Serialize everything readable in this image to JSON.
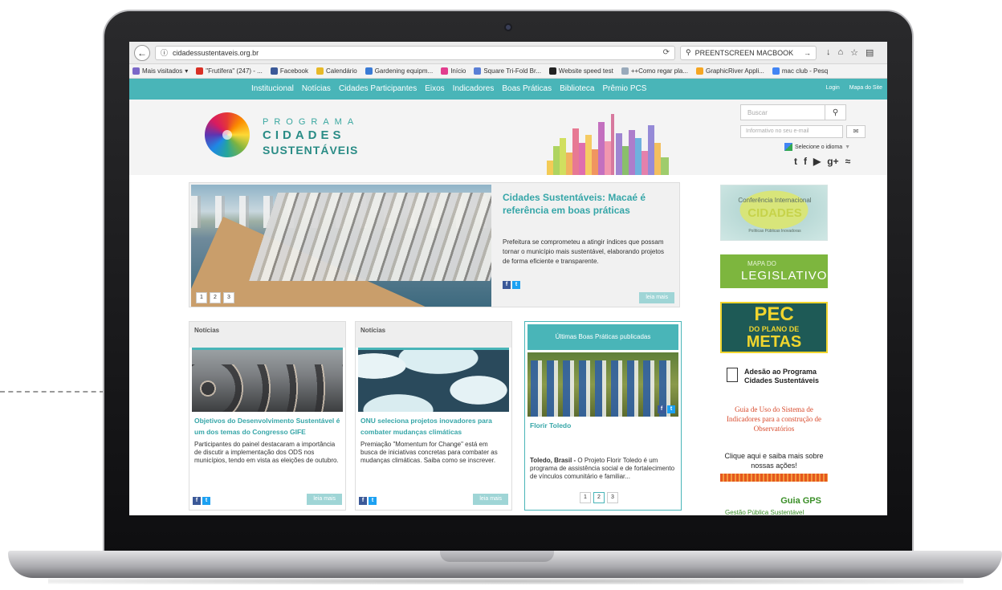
{
  "browser": {
    "url": "cidadessustentaveis.org.br",
    "search_text": "PREENTSCREEN MACBOOK",
    "bookmarks": [
      "Mais visitados",
      "\"Frutífera\" (247) - ...",
      "Facebook",
      "Calendário",
      "Gardening equipm...",
      "Início",
      "Square Tri-Fold Br...",
      "Website speed test",
      "++Como regar pla...",
      "GraphicRiver Appli...",
      "mac club - Pesq"
    ]
  },
  "site_nav": {
    "items": [
      "Institucional",
      "Notícias",
      "Cidades Participantes",
      "Eixos",
      "Indicadores",
      "Boas Práticas",
      "Biblioteca",
      "Prêmio PCS"
    ],
    "login": "Login",
    "sitemap": "Mapa do Site"
  },
  "header": {
    "logo_line1": "PROGRAMA",
    "logo_line2": "CIDADES",
    "logo_line3": "SUSTENTÁVEIS",
    "search_placeholder": "Buscar",
    "newsletter_placeholder": "Informativo no seu e-mail",
    "language_label": "Selecione o idioma",
    "language_caret": "▼"
  },
  "featured": {
    "title": "Cidades Sustentáveis: Macaé é referência em boas práticas",
    "text": "Prefeitura se comprometeu a atingir índices que possam tornar o município mais sustentável, elaborando projetos de forma eficiente e transparente.",
    "pages": [
      "1",
      "2",
      "3"
    ],
    "read_more": "leia mais"
  },
  "cards": [
    {
      "header": "Notícias",
      "title": "Objetivos do Desenvolvimento Sustentável é um dos temas do Congresso GIFE",
      "text": "Participantes do painel destacaram a importância de discutir a implementação dos ODS nos municípios, tendo em vista as eleições de outubro.",
      "read_more": "leia mais"
    },
    {
      "header": "Notícias",
      "title": "ONU seleciona projetos inovadores para combater mudanças climáticas",
      "text": "Premiação \"Momentum for Change\" está em busca de iniciativas concretas para combater as mudanças climáticas. Saiba como se inscrever.",
      "read_more": "leia mais"
    }
  ],
  "best_practices": {
    "header": "Últimas Boas Práticas publicadas",
    "title": "Florir Toledo",
    "text_bold": "Toledo, Brasil -",
    "text": " O Projeto Florir Toledo é um programa de assistência social e de fortalecimento de vínculos comunitário e familiar...",
    "pages": [
      "1",
      "2",
      "3"
    ]
  },
  "sidebar": {
    "conf_line1": "Conferência Internacional",
    "conf_line2": "CIDADES",
    "conf_line3": "Políticas Públicas Inovadoras",
    "mapa_line1": "MAPA DO",
    "mapa_line2": "LEGISLATIVO",
    "pec_line1": "PEC",
    "pec_line2": "DO PLANO DE",
    "pec_line3": "METAS",
    "adesao": "Adesão ao Programa Cidades Sustentáveis",
    "guia": "Guia de Uso do Sistema de Indicadores para a construção de Observatórios",
    "clique": "Clique aqui e saiba mais sobre nossas ações!",
    "gps_title": "Guia GPS",
    "gps_sub": "Gestão Pública Sustentável"
  },
  "colors": {
    "teal": "#49b5b8",
    "teal_text": "#36a6a8",
    "facebook": "#3b5998",
    "twitter": "#1da1f2"
  }
}
